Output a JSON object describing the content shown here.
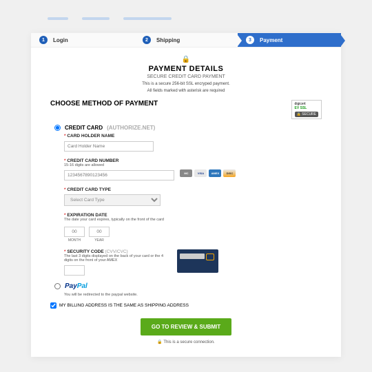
{
  "steps": [
    {
      "num": "1",
      "label": "Login"
    },
    {
      "num": "2",
      "label": "Shipping"
    },
    {
      "num": "3",
      "label": "Payment"
    }
  ],
  "header": {
    "title": "PAYMENT DETAILS",
    "subtitle": "SECURE CREDIT CARD PAYMENT",
    "note": "This is a secure 256-bit SSL encryped payment.",
    "required": "All fields marked with asterisk are required"
  },
  "choose": "CHOOSE METHOD OF PAYMENT",
  "badge": {
    "brand": "digicert",
    "type": "EV SSL",
    "secure": "🔒 SECURE"
  },
  "method": {
    "cc": {
      "label": "CREDIT CARD",
      "gateway": "(AUTHORIZE.NET)"
    },
    "paypal": {
      "redirect": "You will be redirected to the paypal website."
    }
  },
  "fields": {
    "holder": {
      "label": "CARD HOLDER NAME",
      "placeholder": "Card Holder Name"
    },
    "number": {
      "label": "CREDIT CARD NUMBER",
      "hint": "15-16 digits are allowed",
      "placeholder": "1234567890123456"
    },
    "type": {
      "label": "CREDIT CARD TYPE",
      "placeholder": "Select Card Type"
    },
    "exp": {
      "label": "EXPIRATION DATE",
      "hint": "The date your card expires, typically on the front of the card",
      "mm": "00",
      "yy": "00",
      "month": "MONTH",
      "year": "YEAR"
    },
    "cvv": {
      "label": "SECURITY CODE",
      "suffix": "(CVV/CVC)",
      "hint": "The last 3 digits displayed on the back of your card or the 4 digits on the front of your AMEX"
    }
  },
  "billing": "MY BILLING ADDRESS IS THE SAME AS SHIPPING ADDRESS",
  "submit": "GO TO REVIEW & SUBMIT",
  "secure": "This is a secure connection."
}
